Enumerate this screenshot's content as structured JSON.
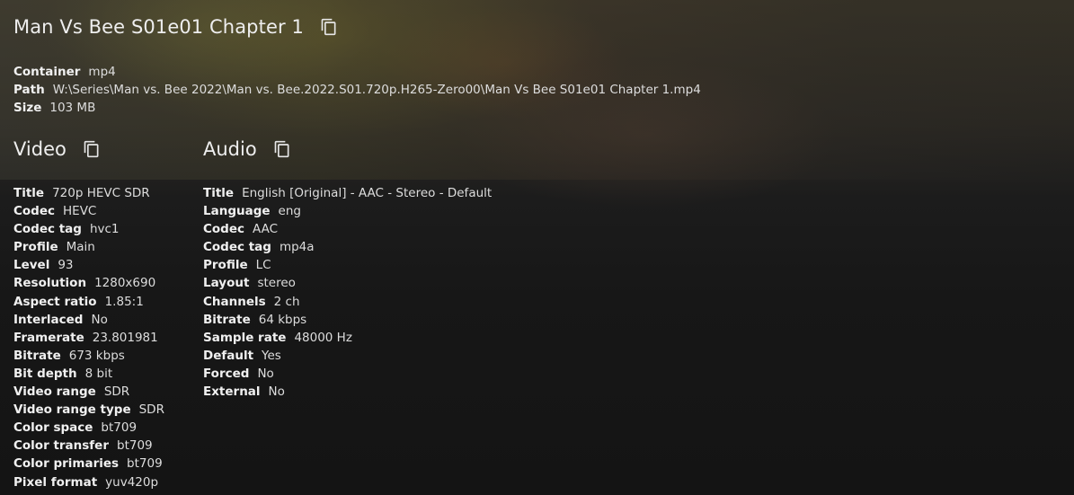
{
  "header": {
    "title": "Man Vs Bee S01e01 Chapter 1",
    "copy_icon": "copy-icon"
  },
  "general": [
    {
      "key": "Container",
      "value": "mp4"
    },
    {
      "key": "Path",
      "value": "W:\\Series\\Man vs. Bee 2022\\Man vs. Bee.2022.S01.720p.H265-Zero00\\Man Vs Bee S01e01 Chapter 1.mp4"
    },
    {
      "key": "Size",
      "value": "103 MB"
    }
  ],
  "video": {
    "title": "Video",
    "copy_icon": "copy-icon",
    "rows": [
      {
        "key": "Title",
        "value": "720p HEVC SDR"
      },
      {
        "key": "Codec",
        "value": "HEVC"
      },
      {
        "key": "Codec tag",
        "value": "hvc1"
      },
      {
        "key": "Profile",
        "value": "Main"
      },
      {
        "key": "Level",
        "value": "93"
      },
      {
        "key": "Resolution",
        "value": "1280x690"
      },
      {
        "key": "Aspect ratio",
        "value": "1.85:1"
      },
      {
        "key": "Interlaced",
        "value": "No"
      },
      {
        "key": "Framerate",
        "value": "23.801981"
      },
      {
        "key": "Bitrate",
        "value": "673 kbps"
      },
      {
        "key": "Bit depth",
        "value": "8 bit"
      },
      {
        "key": "Video range",
        "value": "SDR"
      },
      {
        "key": "Video range type",
        "value": "SDR"
      },
      {
        "key": "Color space",
        "value": "bt709"
      },
      {
        "key": "Color transfer",
        "value": "bt709"
      },
      {
        "key": "Color primaries",
        "value": "bt709"
      },
      {
        "key": "Pixel format",
        "value": "yuv420p"
      }
    ]
  },
  "audio": {
    "title": "Audio",
    "copy_icon": "copy-icon",
    "rows": [
      {
        "key": "Title",
        "value": "English [Original] - AAC - Stereo - Default"
      },
      {
        "key": "Language",
        "value": "eng"
      },
      {
        "key": "Codec",
        "value": "AAC"
      },
      {
        "key": "Codec tag",
        "value": "mp4a"
      },
      {
        "key": "Profile",
        "value": "LC"
      },
      {
        "key": "Layout",
        "value": "stereo"
      },
      {
        "key": "Channels",
        "value": "2 ch"
      },
      {
        "key": "Bitrate",
        "value": "64 kbps"
      },
      {
        "key": "Sample rate",
        "value": "48000 Hz"
      },
      {
        "key": "Default",
        "value": "Yes"
      },
      {
        "key": "Forced",
        "value": "No"
      },
      {
        "key": "External",
        "value": "No"
      }
    ]
  }
}
